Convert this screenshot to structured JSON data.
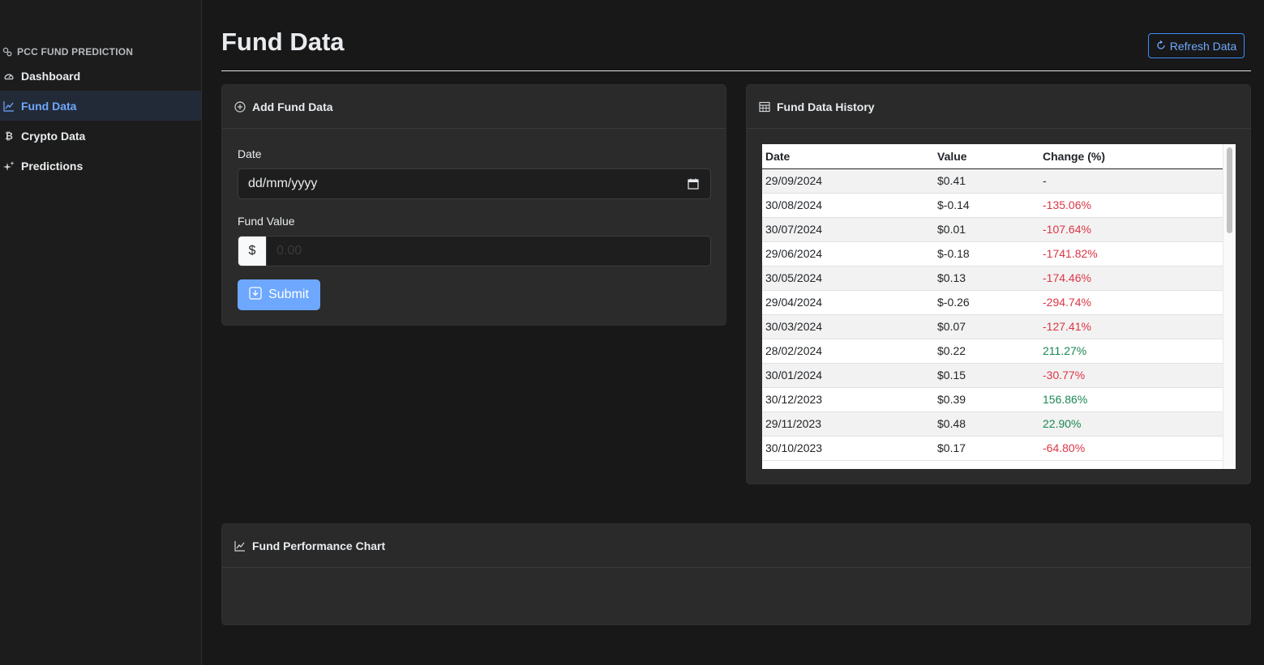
{
  "sidebar": {
    "brand": "PCC FUND PREDICTION",
    "items": [
      {
        "label": "Dashboard",
        "icon": "gauge-icon",
        "active": false
      },
      {
        "label": "Fund Data",
        "icon": "line-chart-icon",
        "active": true
      },
      {
        "label": "Crypto Data",
        "icon": "bitcoin-icon",
        "active": false
      },
      {
        "label": "Predictions",
        "icon": "sparkles-icon",
        "active": false
      }
    ]
  },
  "header": {
    "title": "Fund Data",
    "refresh_label": "Refresh Data"
  },
  "add_form": {
    "title": "Add Fund Data",
    "date_label": "Date",
    "date_placeholder": "dd/mm/yyyy",
    "value_label": "Fund Value",
    "currency_symbol": "$",
    "value_placeholder": "0.00",
    "submit_label": "Submit"
  },
  "history": {
    "title": "Fund Data History",
    "columns": [
      "Date",
      "Value",
      "Change (%)"
    ],
    "rows": [
      {
        "date": "29/09/2024",
        "value": "$0.41",
        "change": "-",
        "trend": "none"
      },
      {
        "date": "30/08/2024",
        "value": "$-0.14",
        "change": "-135.06%",
        "trend": "neg"
      },
      {
        "date": "30/07/2024",
        "value": "$0.01",
        "change": "-107.64%",
        "trend": "neg"
      },
      {
        "date": "29/06/2024",
        "value": "$-0.18",
        "change": "-1741.82%",
        "trend": "neg"
      },
      {
        "date": "30/05/2024",
        "value": "$0.13",
        "change": "-174.46%",
        "trend": "neg"
      },
      {
        "date": "29/04/2024",
        "value": "$-0.26",
        "change": "-294.74%",
        "trend": "neg"
      },
      {
        "date": "30/03/2024",
        "value": "$0.07",
        "change": "-127.41%",
        "trend": "neg"
      },
      {
        "date": "28/02/2024",
        "value": "$0.22",
        "change": "211.27%",
        "trend": "pos"
      },
      {
        "date": "30/01/2024",
        "value": "$0.15",
        "change": "-30.77%",
        "trend": "neg"
      },
      {
        "date": "30/12/2023",
        "value": "$0.39",
        "change": "156.86%",
        "trend": "pos"
      },
      {
        "date": "29/11/2023",
        "value": "$0.48",
        "change": "22.90%",
        "trend": "pos"
      },
      {
        "date": "30/10/2023",
        "value": "$0.17",
        "change": "-64.80%",
        "trend": "neg"
      }
    ]
  },
  "chart_card": {
    "title": "Fund Performance Chart"
  },
  "colors": {
    "accent": "#6ea8fe",
    "negative": "#dc3545",
    "positive": "#198754"
  }
}
